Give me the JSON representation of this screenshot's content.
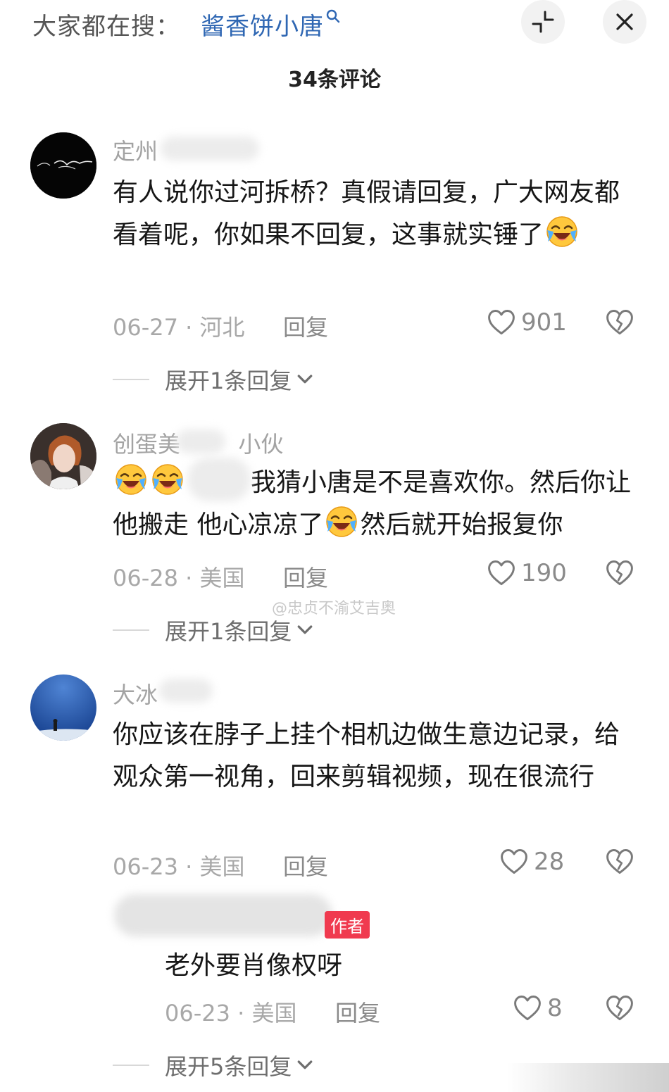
{
  "header": {
    "search_prompt": "大家都在搜：",
    "search_term": "酱香饼小唐",
    "comment_count": "34条评论"
  },
  "comments": [
    {
      "username": "定州",
      "text": "有人说你过河拆桥？真假请回复，广大网友都看着呢，你如果不回复，这事就实锤了",
      "date": "06-27",
      "location": "河北",
      "reply_label": "回复",
      "likes": "901",
      "expand_label": "展开1条回复"
    },
    {
      "username": "创蛋美",
      "username_suffix": "小伙",
      "text_1": "我猜小唐是不是喜欢你。然后你让他搬走 他心凉凉了",
      "text_2": "然后就开始报复你",
      "date": "06-28",
      "location": "美国",
      "reply_label": "回复",
      "likes": "190",
      "expand_label": "展开1条回复"
    },
    {
      "username": "大冰",
      "text": "你应该在脖子上挂个相机边做生意边记录，给观众第一视角，回来剪辑视频，现在很流行",
      "date": "06-23",
      "location": "美国",
      "reply_label": "回复",
      "likes": "28",
      "reply": {
        "badge": "作者",
        "text": "老外要肖像权呀",
        "date": "06-23",
        "location": "美国",
        "reply_label": "回复",
        "likes": "8"
      },
      "expand_label": "展开5条回复"
    }
  ],
  "watermark": "@忠贞不渝艾吉奥",
  "icons": {
    "collapse": "collapse-icon",
    "close": "close-icon",
    "like": "heart-icon",
    "dislike": "broken-heart-icon",
    "expand": "chevron-down-icon",
    "emoji": "laugh-cry-emoji-icon"
  },
  "colors": {
    "link": "#2f67b3",
    "badge": "#f03a4f",
    "muted": "#a8a8a8"
  }
}
